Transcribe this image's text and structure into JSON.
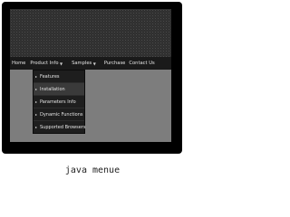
{
  "menu": {
    "items": [
      {
        "label": "Home"
      },
      {
        "label": "Product Info"
      },
      {
        "label": "Samples"
      },
      {
        "label": "Purchase"
      },
      {
        "label": "Contact Us"
      }
    ]
  },
  "submenu": {
    "items": [
      {
        "label": "Features"
      },
      {
        "label": "Installation"
      },
      {
        "label": "Parameters Info"
      },
      {
        "label": "Dynamic Functions"
      },
      {
        "label": "Supported Browsers"
      }
    ]
  },
  "caption": "java menue",
  "colors": {
    "frame": "#000000",
    "panel": "#7d7d7d",
    "menu_bg": "#1a1a1a",
    "text": "#e6e6e6"
  }
}
